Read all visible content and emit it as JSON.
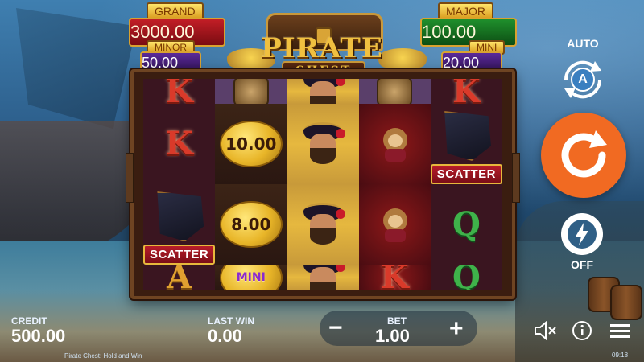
{
  "game": {
    "title_main": "PIRATE",
    "title_sub": "CHEST"
  },
  "jackpots": {
    "grand": {
      "label": "GRAND",
      "value": "3000.00"
    },
    "minor": {
      "label": "MINOR",
      "value": "50.00"
    },
    "major": {
      "label": "MAJOR",
      "value": "100.00"
    },
    "mini": {
      "label": "MINI",
      "value": "20.00"
    }
  },
  "reels": {
    "col1": [
      {
        "type": "letter",
        "text": "K"
      },
      {
        "type": "letter",
        "text": "K"
      },
      {
        "type": "scatter",
        "text": "SCATTER"
      },
      {
        "type": "letter",
        "text": "A"
      }
    ],
    "col2": [
      {
        "type": "compass",
        "text": ""
      },
      {
        "type": "coin",
        "text": "10.00"
      },
      {
        "type": "coin",
        "text": "8.00"
      },
      {
        "type": "coin",
        "text": "MINI"
      }
    ],
    "col3": [
      {
        "type": "pirate",
        "text": ""
      },
      {
        "type": "pirate",
        "text": ""
      },
      {
        "type": "pirate",
        "text": ""
      },
      {
        "type": "pirate",
        "text": ""
      }
    ],
    "col4": [
      {
        "type": "compass",
        "text": ""
      },
      {
        "type": "monkey",
        "text": ""
      },
      {
        "type": "monkey",
        "text": ""
      },
      {
        "type": "letter",
        "text": "K"
      }
    ],
    "col5": [
      {
        "type": "letter",
        "text": "K"
      },
      {
        "type": "scatter",
        "text": "SCATTER"
      },
      {
        "type": "letter",
        "text": "Q"
      },
      {
        "type": "letter",
        "text": "Q"
      }
    ]
  },
  "controls": {
    "auto_label": "AUTO",
    "auto_icon_letter": "A",
    "turbo_label": "OFF",
    "spin_icon": "refresh-arrow-icon",
    "turbo_icon": "lightning-icon"
  },
  "bottom": {
    "credit_label": "CREDIT",
    "credit_value": "500.00",
    "last_win_label": "LAST WIN",
    "last_win_value": "0.00",
    "bet_label": "BET",
    "bet_value": "1.00",
    "minus": "−",
    "plus": "+",
    "footer_left": "Pirate Chest: Hold and Win",
    "clock": "09:18"
  },
  "colors": {
    "spin": "#f16a22",
    "grand_bg": "#c21e26",
    "major_bg": "#1f8f2c",
    "minor_mini_bg": "#5a2a9a"
  }
}
